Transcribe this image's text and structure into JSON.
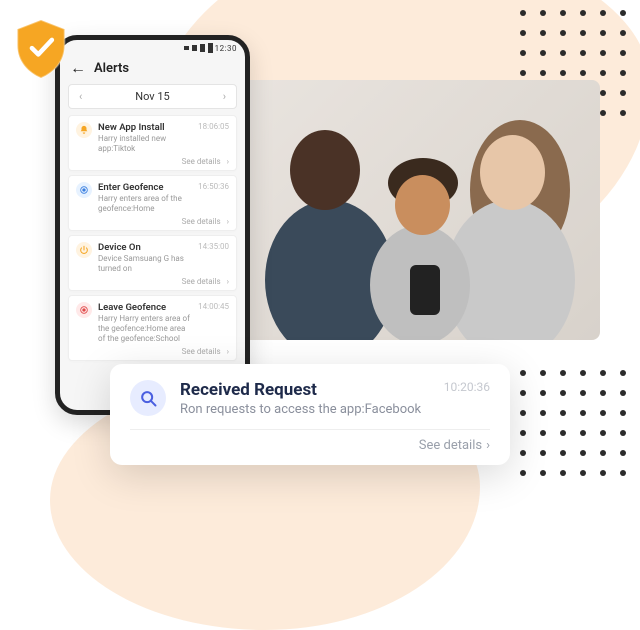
{
  "statusbar": {
    "time": "12:30"
  },
  "screen": {
    "title": "Alerts",
    "date_label": "Nov 15"
  },
  "alerts": [
    {
      "icon": "bell",
      "theme": "orange",
      "title": "New App Install",
      "desc": "Harry installed new app:Tiktok",
      "time": "18:06:05"
    },
    {
      "icon": "target",
      "theme": "blue",
      "title": "Enter Geofence",
      "desc": "Harry enters area of the geofence:Home",
      "time": "16:50:36"
    },
    {
      "icon": "power",
      "theme": "orange",
      "title": "Device On",
      "desc": "Device Samsuang G has turned on",
      "time": "14:35:00"
    },
    {
      "icon": "target",
      "theme": "red",
      "title": "Leave Geofence",
      "desc": "Harry Harry enters area of the geofence:Home area of the geofence:School",
      "time": "14:00:45"
    }
  ],
  "see_details_label": "See details",
  "popup": {
    "title": "Received Request",
    "desc": "Ron requests to access the app:Facebook",
    "time": "10:20:36"
  }
}
